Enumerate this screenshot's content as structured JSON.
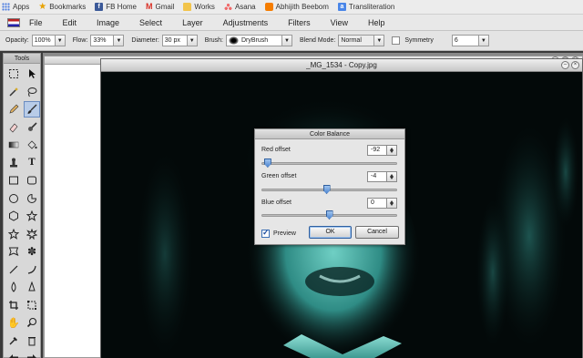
{
  "bookmarks": [
    {
      "label": "Apps",
      "icon": "apps-grid-icon"
    },
    {
      "label": "Bookmarks",
      "icon": "star-icon"
    },
    {
      "label": "FB Home",
      "icon": "facebook-icon"
    },
    {
      "label": "Gmail",
      "icon": "gmail-icon"
    },
    {
      "label": "Works",
      "icon": "folder-icon"
    },
    {
      "label": "Asana",
      "icon": "asana-icon"
    },
    {
      "label": "Abhijith Beebom",
      "icon": "blogger-icon"
    },
    {
      "label": "Transliteration",
      "icon": "transliteration-icon"
    }
  ],
  "menu": [
    "File",
    "Edit",
    "Image",
    "Select",
    "Layer",
    "Adjustments",
    "Filters",
    "View",
    "Help"
  ],
  "options": {
    "opacity_label": "Opacity:",
    "opacity_value": "100%",
    "flow_label": "Flow:",
    "flow_value": "33%",
    "diameter_label": "Diameter:",
    "diameter_value": "30 px",
    "brush_label": "Brush:",
    "brush_value": "DryBrush",
    "blend_label": "Blend Mode:",
    "blend_value": "Normal",
    "symmetry_label": "Symmetry",
    "symmetry_value": "6"
  },
  "tools_title": "Tools",
  "document": {
    "title": "_MG_1534 - Copy.jpg"
  },
  "dialog": {
    "title": "Color Balance",
    "red_label": "Red offset",
    "red_value": "-92",
    "red_level": -92,
    "green_label": "Green offset",
    "green_value": "-4",
    "green_level": -4,
    "blue_label": "Blue offset",
    "blue_value": "0",
    "blue_level": 0,
    "slider_range": [
      -100,
      100
    ],
    "preview_label": "Preview",
    "preview_checked": true,
    "ok_label": "OK",
    "cancel_label": "Cancel"
  },
  "colors": {
    "accent": "#4f86d0",
    "photo_tint": "#3fa8a0"
  }
}
